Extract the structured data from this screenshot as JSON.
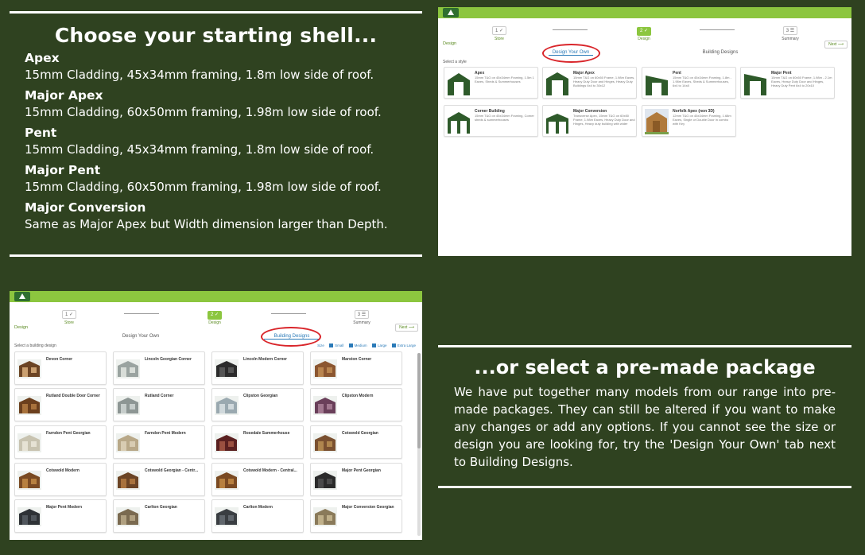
{
  "shell": {
    "heading": "Choose your starting shell...",
    "items": [
      {
        "name": "Apex",
        "desc": "15mm Cladding, 45x34mm framing, 1.8m low side of roof."
      },
      {
        "name": "Major Apex",
        "desc": "15mm Cladding, 60x50mm framing, 1.98m low side of roof."
      },
      {
        "name": "Pent",
        "desc": "15mm Cladding, 45x34mm framing, 1.8m low side of roof."
      },
      {
        "name": "Major Pent",
        "desc": "15mm Cladding, 60x50mm framing, 1.98m low side of roof."
      },
      {
        "name": "Major Conversion",
        "desc": "Same as Major Apex but Width dimension larger than Depth."
      }
    ]
  },
  "package": {
    "heading": "...or select a pre-made package",
    "body": "We have put together many models from our range into pre-made packages. They can still be altered if you want to make any changes or add any options. If you cannot see the size or design you are looking for, try the 'Design Your Own' tab next to Building Designs."
  },
  "app": {
    "steps": [
      {
        "num": "1",
        "label": "Store",
        "done": true
      },
      {
        "num": "2",
        "label": "Design",
        "done": true
      },
      {
        "num": "3",
        "label": "Summary",
        "done": false
      }
    ],
    "breadcrumb": "Design",
    "next_label": "Next ⟶",
    "tabs": {
      "own": "Design Your Own",
      "designs": "Building Designs"
    }
  },
  "shot_styles": {
    "select_label": "Select a style",
    "cards": [
      {
        "title": "Apex",
        "desc": "15mm T&G on 45x34mm Framing, 1.5m 1 Eaves, Sheds & Summerhouses"
      },
      {
        "title": "Major Apex",
        "desc": "15mm T&G on 60x50 Frame, 1.98m Eaves, Heavy Duty Door and Hinges, Heavy Duty Buildings 6x4 to 30x12"
      },
      {
        "title": "Pent",
        "desc": "15mm T&G on 45x34mm Framing, 1.8m - 1.98m Eaves, Sheds & Summerhouses, 6x4 to 14x8"
      },
      {
        "title": "Major Pent",
        "desc": "15mm T&G on 60x50 Frame, 1.98m - 2.1m Eaves, Heavy Duty Door and Hinges, Heavy Duty Pent 6x4 to 20x10"
      },
      {
        "title": "Corner Building",
        "desc": "15mm T&G on 45x34mm Framing, Corner sheds & summerhouses"
      },
      {
        "title": "Major Conversion",
        "desc": "Transverse Apex, 15mm T&G on 60x50 Frame, 1.98m Eaves, Heavy Duty Door and Hinges, Heavy duty building with wider"
      },
      {
        "title": "Norfolk Apex (non 3D)",
        "desc": "12mm T&G on 45x34mm Framing, 1.68m Eaves, Single or Double Door in combo with Key"
      }
    ]
  },
  "shot_designs": {
    "select_label": "Select a building design",
    "size_filter": [
      "Size",
      "Small",
      "Medium",
      "Large",
      "Extra Large"
    ],
    "cards": [
      "Devon Corner",
      "Lincoln Georgian Corner",
      "Lincoln Modern Corner",
      "Marston Corner",
      "Rutland Double Door Corner",
      "Rutland Corner",
      "Clipston Georgian",
      "Clipston Modern",
      "Farndon Pent Georgian",
      "Farndon Pent Modern",
      "Rosedale Summerhouse",
      "Cotswold Georgian",
      "Cotswold Modern",
      "Cotswold Georgian - Centr...",
      "Cotswold Modern - Central...",
      "Major Pent Georgian",
      "Major Pent Modern",
      "Carlton Georgian",
      "Carlton Modern",
      "Major Conversion Georgian"
    ]
  },
  "colors": {
    "background": "#2f4220",
    "brand_green": "#8cc63f",
    "link_blue": "#2a7ab8",
    "highlight_red": "#d9252a"
  }
}
